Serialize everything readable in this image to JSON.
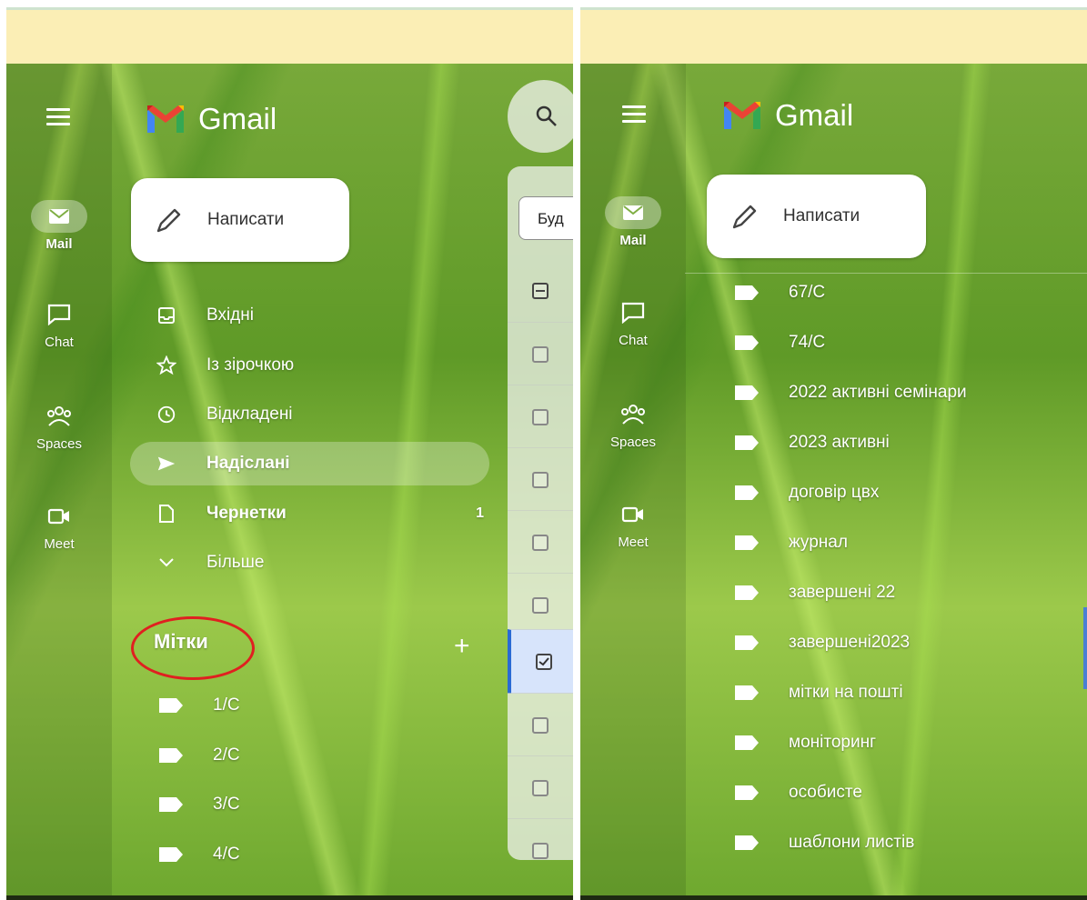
{
  "left_panel": {
    "app_name": "Gmail",
    "rail": [
      {
        "label": "Mail",
        "icon": "mail-icon",
        "active": true
      },
      {
        "label": "Chat",
        "icon": "chat-icon",
        "active": false
      },
      {
        "label": "Spaces",
        "icon": "spaces-icon",
        "active": false
      },
      {
        "label": "Meet",
        "icon": "meet-icon",
        "active": false
      }
    ],
    "compose_label": "Написати",
    "nav": [
      {
        "label": "Вхідні",
        "icon": "inbox-icon",
        "bold": false
      },
      {
        "label": "Із зірочкою",
        "icon": "star-icon",
        "bold": false
      },
      {
        "label": "Відкладені",
        "icon": "clock-icon",
        "bold": false
      },
      {
        "label": "Надіслані",
        "icon": "send-icon",
        "bold": true,
        "active": true
      },
      {
        "label": "Чернетки",
        "icon": "draft-icon",
        "bold": true,
        "count": "1"
      },
      {
        "label": "Більше",
        "icon": "chevron-down-icon",
        "bold": false
      }
    ],
    "labels_heading": "Мітки",
    "add_label": "+",
    "labels": [
      "1/С",
      "2/С",
      "3/С",
      "4/С"
    ],
    "filter_text": "Буд"
  },
  "right_panel": {
    "app_name": "Gmail",
    "rail": [
      {
        "label": "Mail",
        "icon": "mail-icon",
        "active": true
      },
      {
        "label": "Chat",
        "icon": "chat-icon",
        "active": false
      },
      {
        "label": "Spaces",
        "icon": "spaces-icon",
        "active": false
      },
      {
        "label": "Meet",
        "icon": "meet-icon",
        "active": false
      }
    ],
    "compose_label": "Написати",
    "labels": [
      "67/С",
      "74/С",
      "2022 активні семінари",
      "2023 активні",
      "договір цвх",
      "журнал",
      "завершені 22",
      "завершені2023",
      "мітки на пошті",
      "моніторинг",
      "особисте",
      "шаблони листів"
    ]
  },
  "colors": {
    "topbar": "#fbeeb5",
    "annotation_circle": "#e02020",
    "selected_row": "#d7e4fb",
    "label_tag": "#ffffff"
  }
}
